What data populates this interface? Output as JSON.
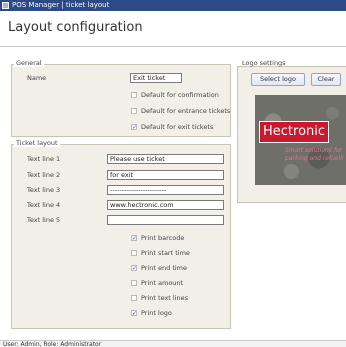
{
  "window": {
    "title": "POS Manager | ticket layout"
  },
  "page": {
    "title": "Layout configuration"
  },
  "general": {
    "group_title": "General",
    "name_label": "Name",
    "name_value": "Exit ticket",
    "checks": [
      {
        "label": "Default for confirmation",
        "checked": false
      },
      {
        "label": "Default for entrance tickets",
        "checked": false
      },
      {
        "label": "Default for exit tickets",
        "checked": true
      }
    ]
  },
  "ticket_layout": {
    "group_title": "Ticket layout",
    "lines": [
      {
        "label": "Text line 1",
        "value": "Please use ticket"
      },
      {
        "label": "Text line 2",
        "value": "for exit"
      },
      {
        "label": "Text line 3",
        "value": "------------------------"
      },
      {
        "label": "Text line 4",
        "value": "www.hectronic.com"
      },
      {
        "label": "Text line 5",
        "value": ""
      }
    ],
    "options": [
      {
        "label": "Print barcode",
        "checked": true
      },
      {
        "label": "Print start time",
        "checked": false
      },
      {
        "label": "Print end time",
        "checked": true
      },
      {
        "label": "Print amount",
        "checked": false
      },
      {
        "label": "Print text lines",
        "checked": false
      },
      {
        "label": "Print logo",
        "checked": true
      }
    ]
  },
  "logo_settings": {
    "group_title": "Logo settings",
    "select_label": "Select logo",
    "clear_label": "Clear",
    "logo_text": "Hectronic",
    "logo_tagline_1": "Smart solutions for",
    "logo_tagline_2": "parking and refuelli",
    "brand_color": "#c8192e"
  },
  "status": {
    "text": "User: Admin, Role: Administrator"
  },
  "check_glyph": "✓"
}
